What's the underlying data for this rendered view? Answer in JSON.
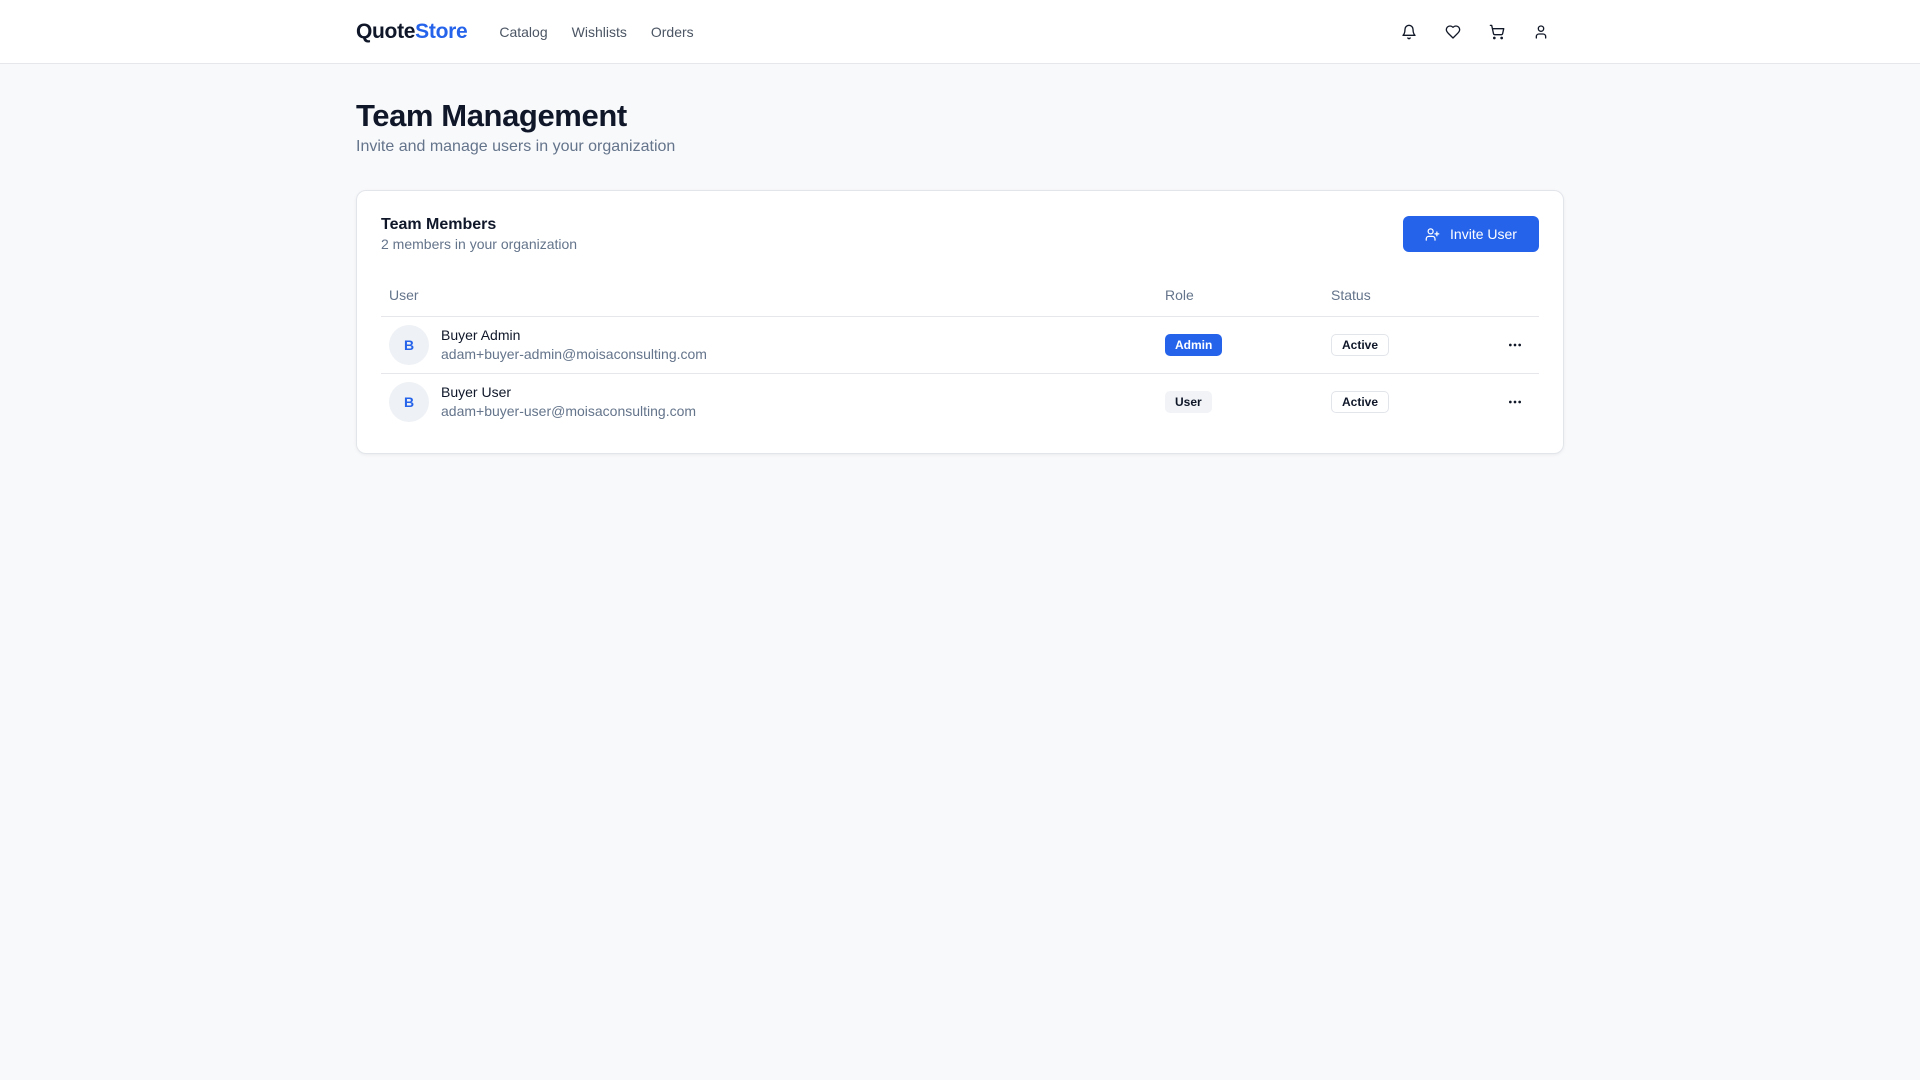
{
  "header": {
    "logo_part1": "Quote",
    "logo_part2": "Store",
    "nav": [
      {
        "label": "Catalog"
      },
      {
        "label": "Wishlists"
      },
      {
        "label": "Orders"
      }
    ],
    "icons": [
      "bell-icon",
      "heart-icon",
      "cart-icon",
      "user-icon"
    ]
  },
  "page": {
    "title": "Team Management",
    "subtitle": "Invite and manage users in your organization"
  },
  "card": {
    "title": "Team Members",
    "subtitle": "2 members in your organization",
    "invite_label": "Invite User"
  },
  "table": {
    "columns": [
      "User",
      "Role",
      "Status"
    ],
    "rows": [
      {
        "initial": "B",
        "name": "Buyer Admin",
        "email": "adam+buyer-admin@moisaconsulting.com",
        "role": "Admin",
        "status": "Active"
      },
      {
        "initial": "B",
        "name": "Buyer User",
        "email": "adam+buyer-user@moisaconsulting.com",
        "role": "User",
        "status": "Active"
      }
    ]
  },
  "colors": {
    "accent": "#2563eb",
    "background": "#f8f9fb"
  }
}
